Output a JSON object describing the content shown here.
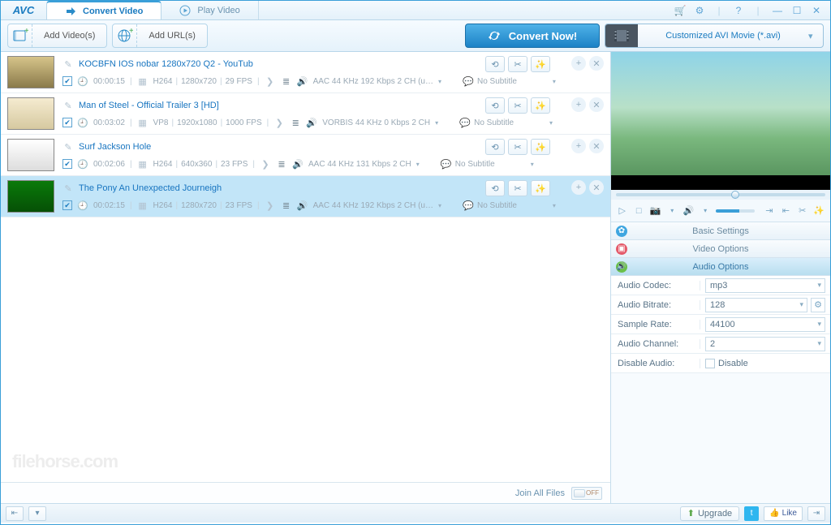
{
  "app": {
    "logo": "AVC"
  },
  "tabs": {
    "convert": "Convert Video",
    "play": "Play Video"
  },
  "toolbar": {
    "add_videos": "Add Video(s)",
    "add_urls": "Add URL(s)",
    "convert_now": "Convert Now!",
    "preset": "Customized AVI Movie (*.avi)"
  },
  "files": [
    {
      "title": "KOCBFN IOS nobar 1280x720 Q2 - YouTub",
      "duration": "00:00:15",
      "vcodec": "H264",
      "resolution": "1280x720",
      "fps": "29 FPS",
      "audio": "AAC 44 KHz 192 Kbps 2 CH (u…",
      "subtitle": "No Subtitle",
      "thumb": "sand"
    },
    {
      "title": "Man of Steel - Official Trailer 3 [HD]",
      "duration": "00:03:02",
      "vcodec": "VP8",
      "resolution": "1920x1080",
      "fps": "1000 FPS",
      "audio": "VORBIS 44 KHz 0 Kbps 2 CH",
      "subtitle": "No Subtitle",
      "thumb": "light"
    },
    {
      "title": "Surf Jackson Hole",
      "duration": "00:02:06",
      "vcodec": "H264",
      "resolution": "640x360",
      "fps": "23 FPS",
      "audio": "AAC 44 KHz 131 Kbps 2 CH",
      "subtitle": "No Subtitle",
      "thumb": "white"
    },
    {
      "title": "The Pony An Unexpected Journeigh",
      "duration": "00:02:15",
      "vcodec": "H264",
      "resolution": "1280x720",
      "fps": "23 FPS",
      "audio": "AAC 44 KHz 192 Kbps 2 CH (u…",
      "subtitle": "No Subtitle",
      "thumb": "green"
    }
  ],
  "joinbar": {
    "label": "Join All Files",
    "state": "OFF"
  },
  "accordions": {
    "basic": "Basic Settings",
    "video": "Video Options",
    "audio": "Audio Options"
  },
  "audio_opts": {
    "codec_label": "Audio Codec:",
    "codec": "mp3",
    "bitrate_label": "Audio Bitrate:",
    "bitrate": "128",
    "sample_label": "Sample Rate:",
    "sample": "44100",
    "channel_label": "Audio Channel:",
    "channel": "2",
    "disable_label": "Disable Audio:",
    "disable_val": "Disable"
  },
  "status": {
    "upgrade": "Upgrade",
    "like": "Like"
  },
  "watermark": "filehorse.com"
}
